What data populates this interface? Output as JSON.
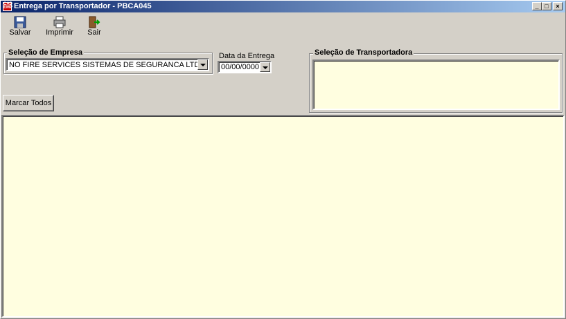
{
  "window": {
    "title": "Entrega por Transportador - PBCA045",
    "icon_text": "CAD EMP",
    "controls": [
      "_",
      "□",
      "×"
    ]
  },
  "toolbar": {
    "save_label": "Salvar",
    "print_label": "Imprimir",
    "exit_label": "Sair"
  },
  "empresa": {
    "group_label": "Seleção de Empresa",
    "selected": "NO FIRE SERVICES SISTEMAS DE SEGURANCA LTDA"
  },
  "data_entrega": {
    "label": "Data da Entrega",
    "value": "00/00/0000"
  },
  "transportadora": {
    "group_label": "Seleção de Transportadora"
  },
  "buttons": {
    "mark_all": "Marcar Todos"
  },
  "colors": {
    "window_bg": "#d4d0c8",
    "panel_bg": "#fffee0",
    "title_start": "#0a246a",
    "title_end": "#a6caf0"
  }
}
